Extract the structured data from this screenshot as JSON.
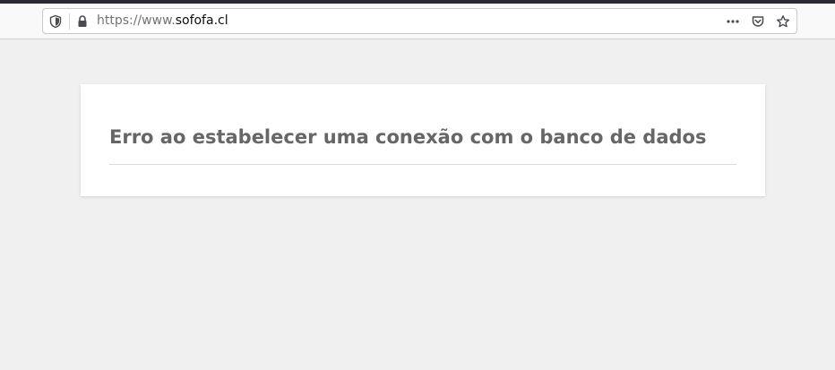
{
  "browser": {
    "url_scheme": "https://www.",
    "url_host": "sofofa.cl",
    "icons": [
      "shield-icon",
      "lock-icon",
      "more-options-icon",
      "pocket-icon",
      "bookmark-star-icon"
    ]
  },
  "page": {
    "error_title": "Erro ao estabelecer uma conexão com o banco de dados"
  }
}
